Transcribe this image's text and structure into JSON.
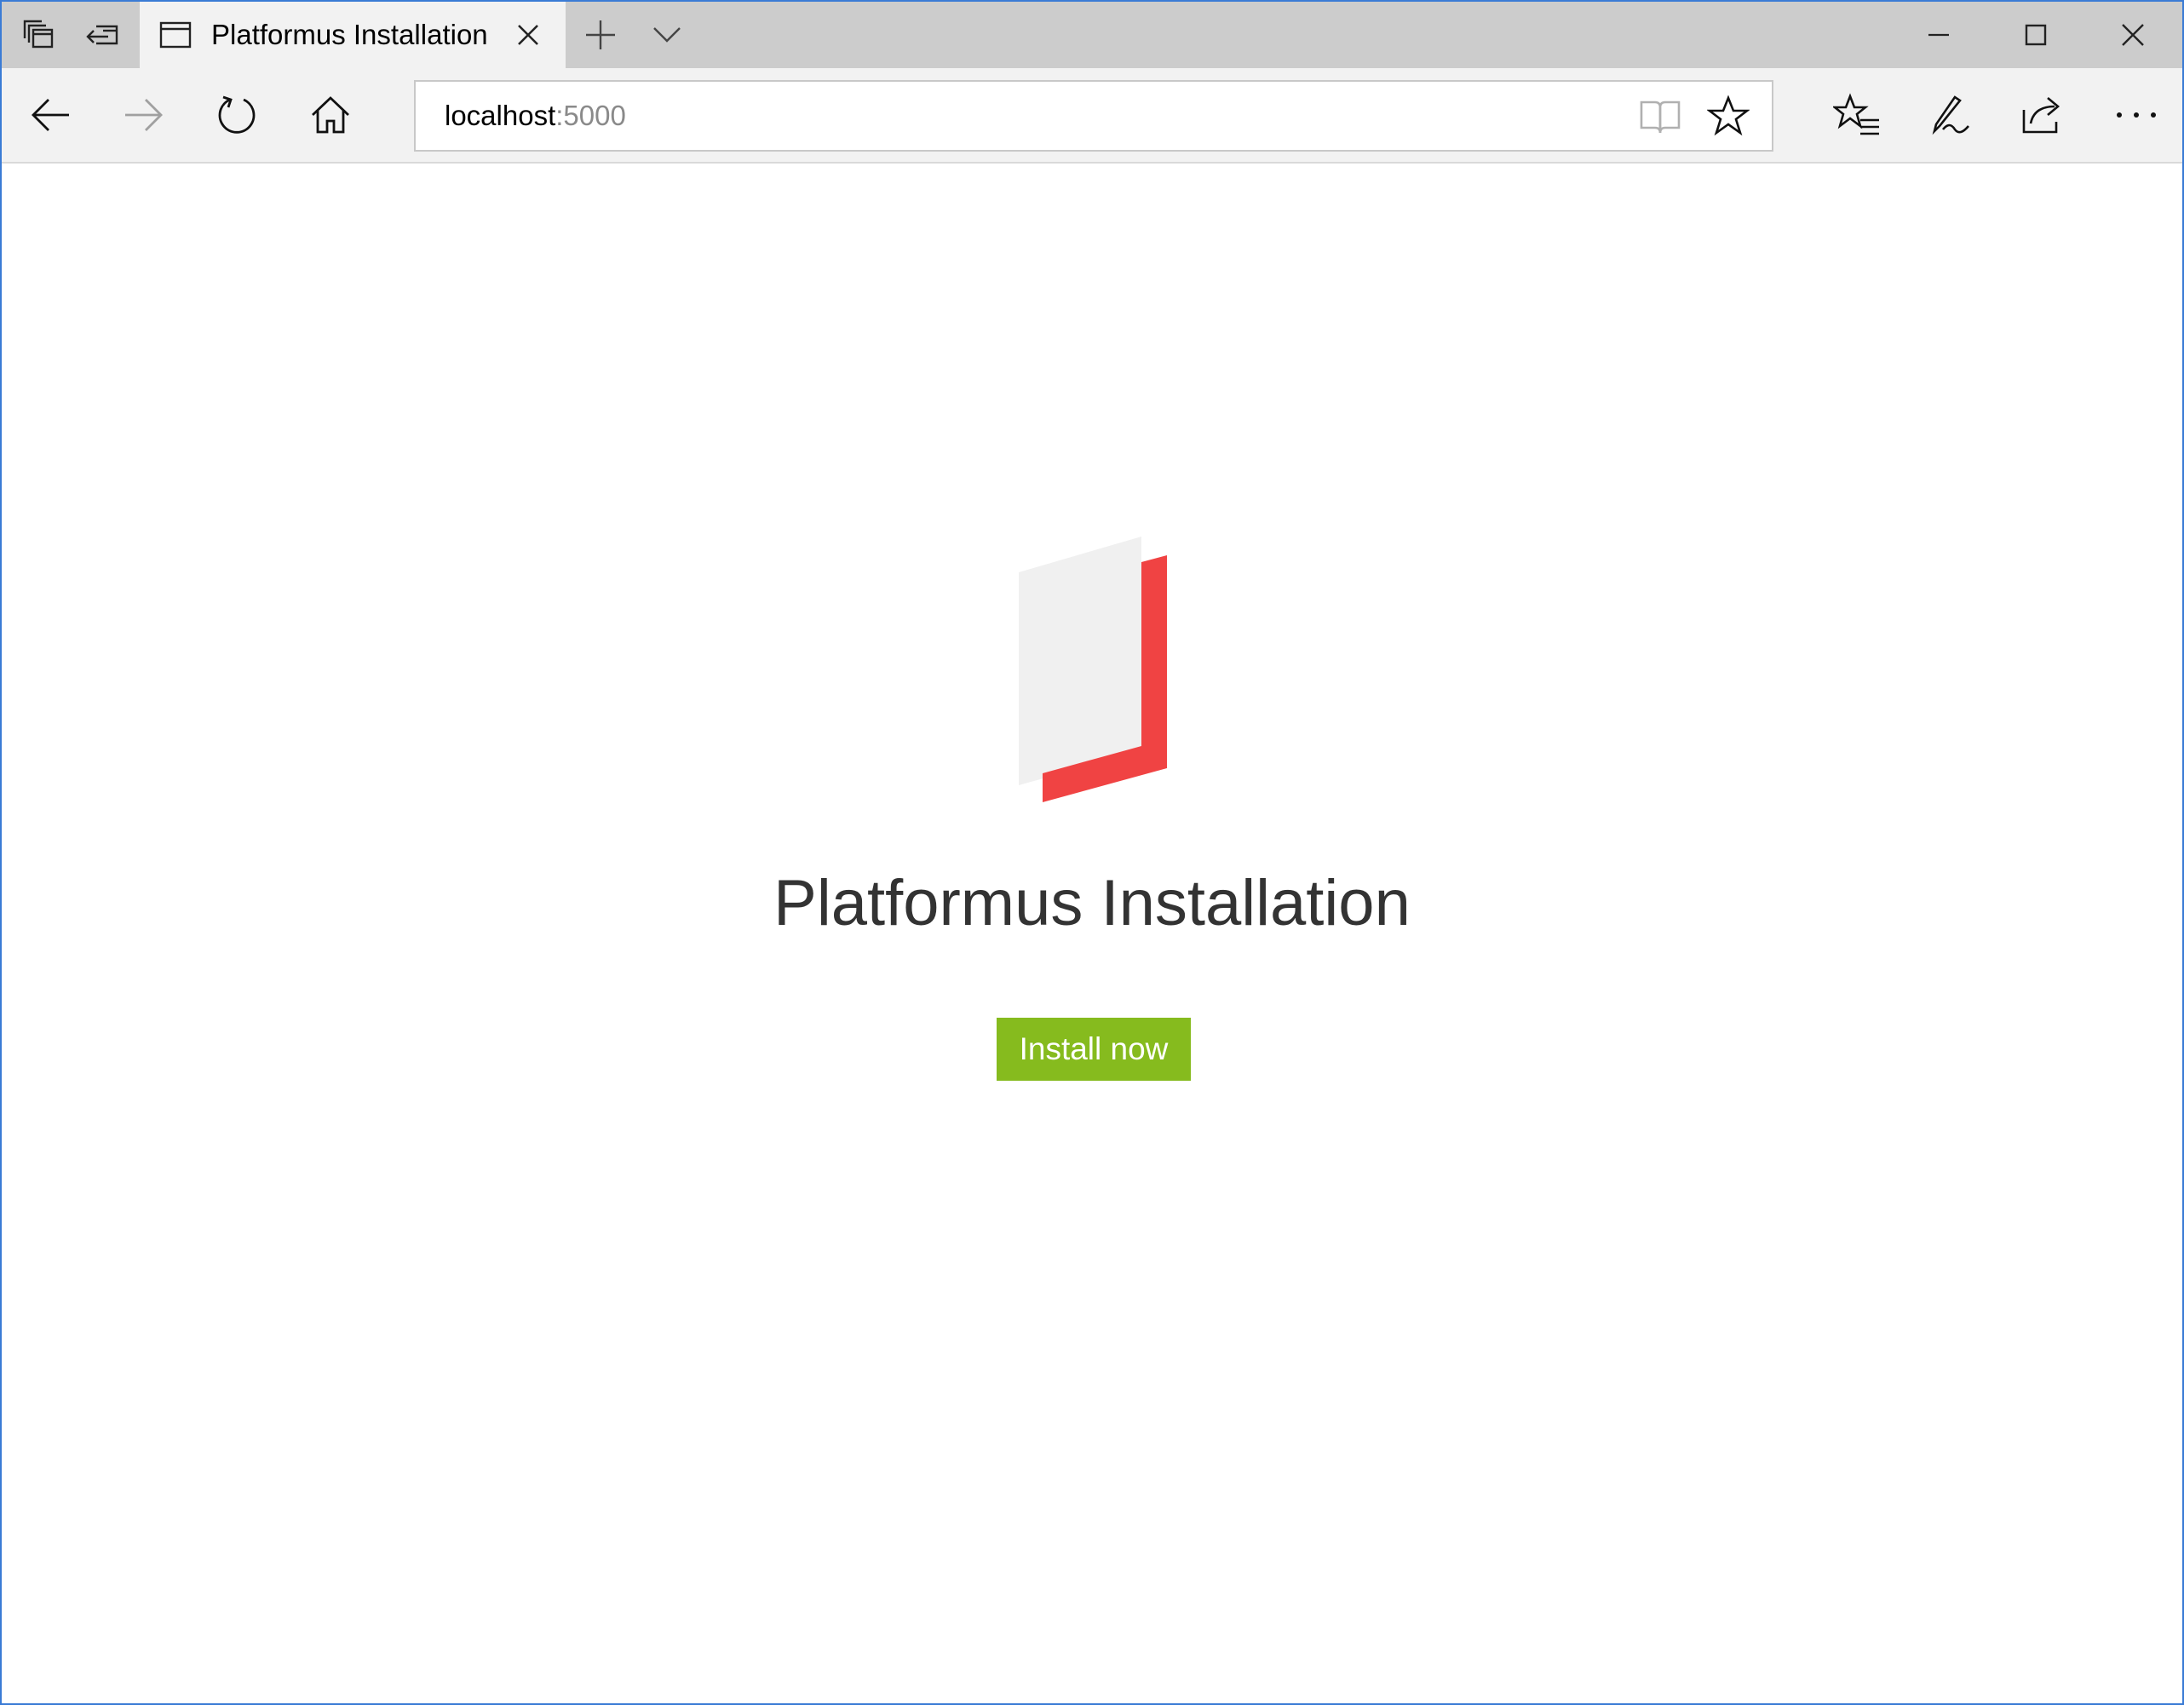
{
  "browser": {
    "tab": {
      "title": "Platformus Installation"
    },
    "tab_icons": [
      "tabs-aside-icon",
      "set-tabs-aside-icon",
      "page-icon",
      "close-tab-icon",
      "new-tab-icon",
      "tab-preview-chevron-icon"
    ],
    "window_controls": [
      "minimize-icon",
      "maximize-icon",
      "close-window-icon"
    ],
    "nav_icons": [
      "back-icon",
      "forward-icon",
      "refresh-icon",
      "home-icon"
    ],
    "address": {
      "host": "localhost",
      "port": ":5000"
    },
    "address_icons": [
      "reading-view-icon",
      "favorite-star-icon"
    ],
    "toolbar_icons": [
      "favorites-hub-icon",
      "web-note-icon",
      "share-icon",
      "more-icon"
    ]
  },
  "page": {
    "title": "Platformus Installation",
    "install_button": "Install now",
    "logo": {
      "panel_color": "#f0f0f0",
      "accent_color": "#f04343"
    },
    "button_color": "#86bb1e"
  }
}
